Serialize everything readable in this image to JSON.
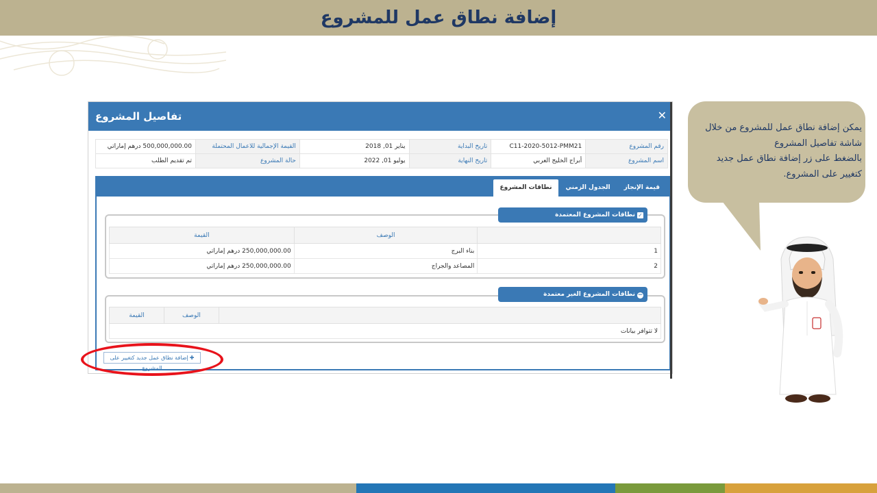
{
  "slide": {
    "title": "إضافة نطاق عمل للمشروع",
    "colors": {
      "top_bar": "#bcb290",
      "title": "#1f3864",
      "accent": "#3a79b5",
      "highlight": "#e8131b"
    },
    "footer_colors": [
      "#bcb290",
      "#2476b6",
      "#7a9a3c",
      "#d8a13c"
    ]
  },
  "modal": {
    "title": "تفاصيل المشروع",
    "close_icon": "close-icon",
    "info": {
      "project_number_label": "رقم المشروع",
      "project_number": "C11-2020-5012-PMM21",
      "start_date_label": "تاريخ البداية",
      "start_date": "يناير 01, 2018",
      "total_value_label": "القيمة الإجمالية للاعمال المحتملة",
      "total_value": "500,000,000.00 درهم إماراتي",
      "project_name_label": "اسم المشروع",
      "project_name": "أبراج الخليج العربي",
      "end_date_label": "تاريخ النهاية",
      "end_date": "يوليو 01, 2022",
      "project_status_label": "حالة المشروع",
      "project_status": "تم تقديم الطلب"
    },
    "tabs": [
      {
        "label": "قيمة الإنجاز"
      },
      {
        "label": "الجدول الزمني"
      },
      {
        "label": "نطاقات المشروع"
      }
    ],
    "approved": {
      "legend": "نطاقات المشروع المعتمدة",
      "icon": "checkbox-icon",
      "headers": [
        "",
        "الوصف",
        "القيمة"
      ],
      "rows": [
        [
          "1",
          "بناء البرج",
          "250,000,000.00 درهم إماراتي"
        ],
        [
          "2",
          "المصاعد والجراج",
          "250,000,000.00 درهم إماراتي"
        ]
      ]
    },
    "unapproved": {
      "legend": "نطاقات المشروع الغير معتمدة",
      "icon": "minus-circle-icon",
      "headers": [
        "",
        "الوصف",
        "القيمة"
      ],
      "no_data": "لا تتوافر بيانات"
    },
    "add_button": {
      "label": "إضافة نطاق عمل جديد كتغيير على المشروع",
      "icon": "plus-icon"
    }
  },
  "callout": {
    "lines": [
      "يمكن إضافة نطاق عمل للمشروع من خلال",
      "شاشة تفاصيل المشروع",
      "بالضغط على زر إضافة نطاق عمل جديد",
      "كتغيير على المشروع."
    ]
  }
}
